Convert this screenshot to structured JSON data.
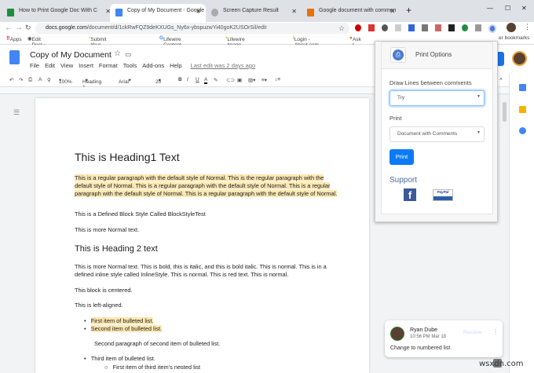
{
  "browser": {
    "tabs": [
      {
        "label": "How to Print Google Doc With C",
        "color": "#1e8e3e"
      },
      {
        "label": "Copy of My Document - Google",
        "color": "#4285f4"
      },
      {
        "label": "Screen Capture Result",
        "color": "#888"
      },
      {
        "label": "Google document with commen",
        "color": "#e8710a"
      }
    ],
    "new_tab": "+",
    "url_domain": "docs.google.com",
    "url_path": "/document/d/1ckRwFQZ9deKXUGs_Ny6x-ybspuzwYi40goK2USOrSil/edit",
    "bookmarks": [
      "Apps",
      "Edit Post ‹ Skyose -...",
      "Submit Your Story |...",
      "Lifewire Content Hu...",
      "Lifewire Image Style...",
      "Login - About.com...",
      "Ask I"
    ],
    "other_bookmarks": "er bookmarks",
    "window_controls": [
      "—",
      "☐",
      "✕"
    ]
  },
  "docs": {
    "title": "Copy of My Document",
    "menu": [
      "File",
      "Edit",
      "View",
      "Insert",
      "Format",
      "Tools",
      "Add-ons",
      "Help"
    ],
    "last_edit": "Last edit was 2 days ago",
    "toolbar": {
      "zoom": "100%",
      "style": "Heading 1",
      "font": "Arial",
      "size": "20",
      "bold": "B",
      "italic": "I",
      "underline": "U",
      "color": "A"
    }
  },
  "document": {
    "heading1": "This is Heading1 Text",
    "para1": "This is a regular paragraph with the default style of Normal. This is the regular paragraph with the default style of Normal. This is a regular paragraph with the default style of Normal. This is a regular paragraph with the default style of Normal. This is a regular paragraph with the default style of Normal.",
    "block_style": "This is a Defined Block Style Called BlockStyleTest",
    "more_normal": "This is more Normal text.",
    "heading2": "This is Heading 2 text",
    "para2": "This is more Normal text. This is bold, this is italic, and this is bold italic. This is normal. This is in a defined inline style called InlineStyle. This is normal. This is red text. This is normal.",
    "centered": "This block is centered.",
    "left_aligned": "This is left-aligned.",
    "bullet1": "First item of bulleted list.",
    "bullet2": "Second item of bulleted list.",
    "second_para": "Second paragraph of second item of bulleted list.",
    "bullet3": "Third item of bulleted list.",
    "nested1": "First item of third item's nested list"
  },
  "popup": {
    "title": "Print Options",
    "draw_lines_label": "Draw Lines between comments",
    "draw_lines_value": "Try",
    "print_label": "Print",
    "print_value": "Document with Comments",
    "print_button": "Print",
    "support": "Support",
    "paypal": "PayPal"
  },
  "comment": {
    "author": "Ryan Dube",
    "time": "10:56 PM Mar 18",
    "text": "Change to numbered list",
    "resolve": "Resolve"
  },
  "watermark": "wsxdn.com"
}
